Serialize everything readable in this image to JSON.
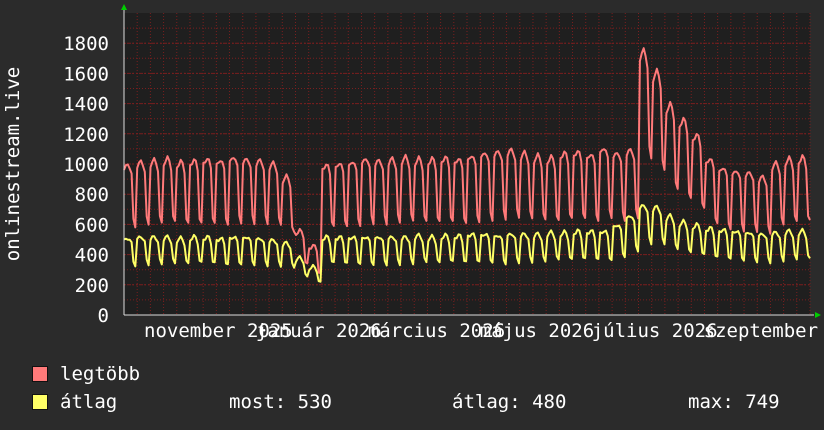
{
  "colors": {
    "background": "#2b2b2b",
    "plot_bg": "#1f1f1f",
    "grid": "#7a1f1f",
    "axis": "#dddddd",
    "arrow": "#00cc00",
    "series_max": "#ff7a7a",
    "series_avg": "#ffff66"
  },
  "chart_data": {
    "type": "line",
    "ylabel": "onlinestream.live",
    "ylim": [
      0,
      2000
    ],
    "y_ticks": [
      0,
      200,
      400,
      600,
      800,
      1000,
      1200,
      1400,
      1600,
      1800
    ],
    "x_tick_labels": [
      "november 2025",
      "január 2026",
      "március 2026",
      "május 2026",
      "július 2026",
      "szeptember"
    ],
    "grid": true,
    "weeks": 52,
    "series": [
      {
        "name": "legtöbb",
        "weekday_values": [
          980,
          1000,
          1020,
          1000,
          950,
          640,
          600
        ],
        "weekly_peaks": [
          1000,
          1020,
          1030,
          1040,
          1020,
          1030,
          1040,
          1030,
          1050,
          1040,
          1030,
          1010,
          920,
          560,
          460,
          1000,
          1010,
          1020,
          1040,
          1030,
          1040,
          1050,
          1040,
          1040,
          1050,
          1040,
          1060,
          1080,
          1090,
          1100,
          1080,
          1060,
          1050,
          1080,
          1090,
          1070,
          1110,
          1080,
          1100,
          1760,
          1620,
          1400,
          1300,
          1200,
          1040,
          980,
          960,
          950,
          920,
          1010,
          1040,
          1050
        ]
      },
      {
        "name": "átlag",
        "weekday_values": [
          500,
          510,
          520,
          510,
          480,
          360,
          340
        ],
        "weekly_peaks": [
          510,
          520,
          520,
          520,
          510,
          520,
          520,
          510,
          520,
          520,
          510,
          500,
          480,
          380,
          320,
          520,
          520,
          520,
          520,
          520,
          520,
          520,
          530,
          520,
          530,
          530,
          540,
          540,
          530,
          540,
          540,
          540,
          550,
          550,
          560,
          560,
          560,
          600,
          660,
          730,
          720,
          660,
          620,
          600,
          580,
          570,
          560,
          550,
          540,
          550,
          560,
          560
        ]
      }
    ]
  },
  "legend": {
    "max_label": "legtöbb",
    "avg_label": "átlag"
  },
  "stats": {
    "most": "most: 530",
    "atlag": "átlag: 480",
    "max": "max: 749"
  }
}
